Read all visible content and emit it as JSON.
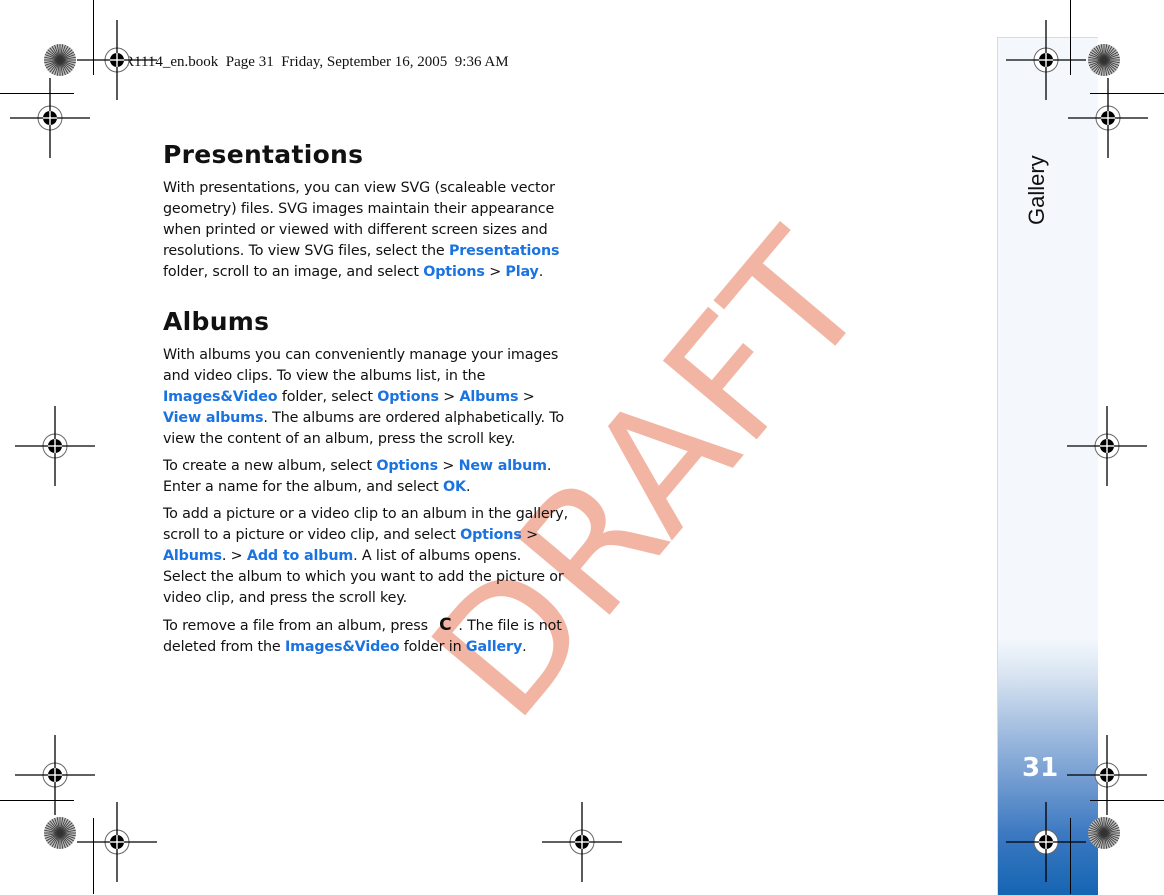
{
  "book_header": "R1114_en.book  Page 31  Friday, September 16, 2005  9:36 AM",
  "sidebar": {
    "section_title": "Gallery",
    "page_number": "31",
    "accent_color": "#1565b2"
  },
  "watermark": "DRAFT",
  "link_color": "#1a73e0",
  "sections": [
    {
      "heading": "Presentations",
      "paragraphs": [
        {
          "parts": [
            "With presentations, you can view SVG (scaleable vector geometry) files. SVG images maintain their appearance when printed or viewed with different screen sizes and resolutions. To view SVG files, select the ",
            "Presentations",
            " folder, scroll to an image, and select ",
            "Options",
            " > ",
            "Play",
            "."
          ]
        }
      ]
    },
    {
      "heading": "Albums",
      "paragraphs": [
        {
          "parts": [
            "With albums you can conveniently manage your images and video clips. To view the albums list, in the ",
            "Images&Video",
            " folder, select ",
            "Options",
            " > ",
            "Albums",
            " > ",
            "View albums",
            ". The albums are ordered alphabetically. To view the content of an album, press the scroll key."
          ]
        },
        {
          "parts": [
            "To create a new album, select ",
            "Options",
            " > ",
            "New album",
            ". Enter a name for the album, and select ",
            "OK",
            "."
          ]
        },
        {
          "parts": [
            "To add a picture or a video clip to an album in the gallery, scroll to a picture or video clip, and select ",
            "Options",
            " > ",
            "Albums",
            ". > ",
            "Add to album",
            ". A list of albums opens. Select the album to which you want to add the picture or video clip, and press the scroll key."
          ]
        },
        {
          "parts": [
            "To remove a file from an album, press ",
            "C",
            ". The file is not deleted from the ",
            "Images&Video",
            " folder in ",
            "Gallery",
            "."
          ]
        }
      ]
    }
  ],
  "icons": {
    "registration_mark": "registration-crosshair",
    "color_wheel": "star-target",
    "clear_key": "C"
  }
}
